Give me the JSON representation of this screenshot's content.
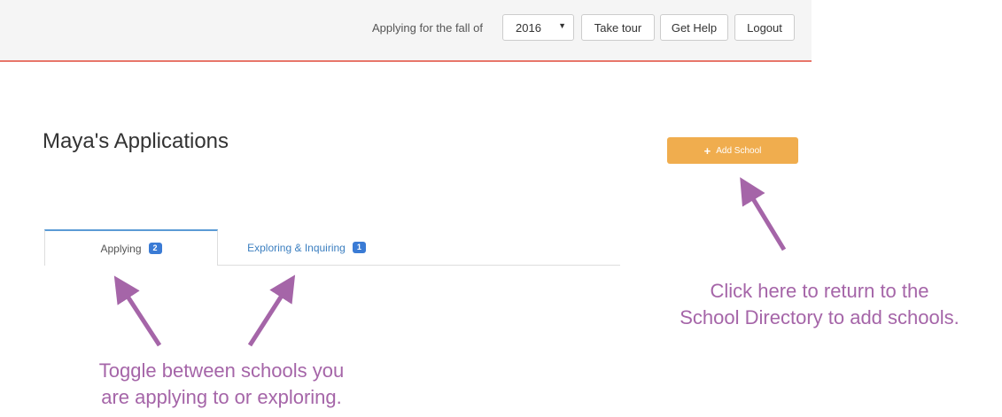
{
  "header": {
    "fall_label": "Applying for the fall of",
    "year_value": "2016",
    "take_tour_label": "Take tour",
    "get_help_label": "Get Help",
    "logout_label": "Logout"
  },
  "main": {
    "title": "Maya's Applications",
    "add_school_label": "Add School",
    "tabs": [
      {
        "label": "Applying",
        "count": "2"
      },
      {
        "label": "Exploring & Inquiring",
        "count": "1"
      }
    ]
  },
  "annotations": {
    "add_school_note": [
      "Click here to return to the",
      "School Directory to add schools."
    ],
    "tabs_note": [
      "Toggle between schools you",
      "are applying to or exploring."
    ]
  },
  "colors": {
    "accent_orange": "#f0ad4e",
    "header_border": "#e8766a",
    "annotation_purple": "#a565a8",
    "badge_blue": "#3a7bd5"
  }
}
